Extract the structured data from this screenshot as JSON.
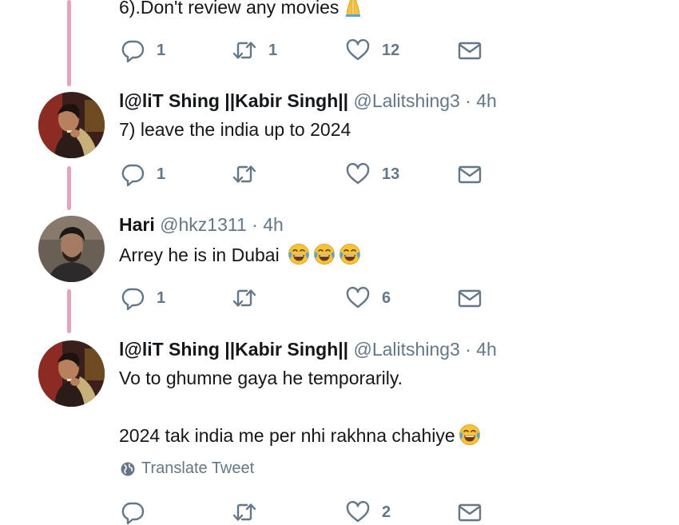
{
  "tweets": [
    {
      "text": "6).Don't review any movies",
      "emojis": [
        "folded-hands"
      ],
      "actions": {
        "replies": "1",
        "retweets": "1",
        "likes": "12"
      }
    },
    {
      "name": "l@liT Shing ||Kabir Singh||",
      "handle": "@Lalitshing3",
      "time": " · 4h",
      "text": "7) leave the india up to 2024",
      "actions": {
        "replies": "1",
        "retweets": "",
        "likes": "13"
      }
    },
    {
      "name": "Hari",
      "handle": "@hkz1311",
      "time": " · 4h",
      "text": "Arrey he is in Dubai",
      "emojis": [
        "tears-of-joy",
        "tears-of-joy",
        "tears-of-joy"
      ],
      "actions": {
        "replies": "1",
        "retweets": "",
        "likes": "6"
      }
    },
    {
      "name": "l@liT Shing ||Kabir Singh||",
      "handle": "@Lalitshing3",
      "time": " · 4h",
      "text_line1": "Vo to ghumne gaya he temporarily.",
      "text_line2": "2024 tak india me per nhi rakhna chahiye",
      "emojis": [
        "tears-of-joy"
      ],
      "translate_label": "Translate Tweet",
      "actions": {
        "replies": "",
        "retweets": "",
        "likes": "2"
      }
    }
  ],
  "colors": {
    "thread_line": "#e4a5b8",
    "secondary_text": "#657786",
    "primary_text": "#14171a"
  }
}
